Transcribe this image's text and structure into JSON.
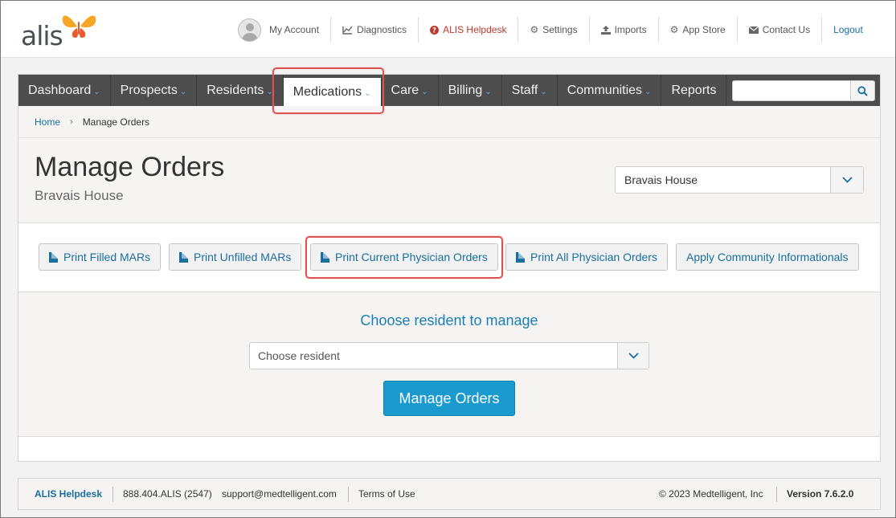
{
  "brand": {
    "logo_text": "alis",
    "logo_color": "#f5a623",
    "logo_accent": "#e85a2c"
  },
  "utility_nav": {
    "my_account": "My Account",
    "diagnostics": "Diagnostics",
    "helpdesk": "ALIS Helpdesk",
    "settings": "Settings",
    "imports": "Imports",
    "app_store": "App Store",
    "contact_us": "Contact Us",
    "logout": "Logout"
  },
  "main_nav": {
    "items": [
      {
        "label": "Dashboard",
        "has_dropdown": true
      },
      {
        "label": "Prospects",
        "has_dropdown": true
      },
      {
        "label": "Residents",
        "has_dropdown": true
      },
      {
        "label": "Medications",
        "has_dropdown": true,
        "active": true
      },
      {
        "label": "Care",
        "has_dropdown": true
      },
      {
        "label": "Billing",
        "has_dropdown": true
      },
      {
        "label": "Staff",
        "has_dropdown": true
      },
      {
        "label": "Communities",
        "has_dropdown": true
      },
      {
        "label": "Reports",
        "has_dropdown": false
      }
    ],
    "search_value": ""
  },
  "breadcrumb": {
    "home": "Home",
    "current": "Manage Orders"
  },
  "page": {
    "title": "Manage Orders",
    "subtitle": "Bravais House",
    "community_selected": "Bravais House"
  },
  "actions": {
    "print_filled_mars": "Print Filled MARs",
    "print_unfilled_mars": "Print Unfilled MARs",
    "print_current_physician_orders": "Print Current Physician Orders",
    "print_all_physician_orders": "Print All Physician Orders",
    "apply_community_informationals": "Apply Community Informationals"
  },
  "manage": {
    "heading": "Choose resident to manage",
    "resident_placeholder": "Choose resident",
    "button": "Manage Orders"
  },
  "footer": {
    "helpdesk": "ALIS Helpdesk",
    "phone": "888.404.ALIS (2547)",
    "email": "support@medtelligent.com",
    "terms": "Terms of Use",
    "copyright": "© 2023 Medtelligent, Inc",
    "version": "Version 7.6.2.0"
  },
  "colors": {
    "nav_bg": "#4d4d4d",
    "link_blue": "#1a6fa0",
    "primary_button": "#1b9ad0",
    "highlight_red": "#e05252",
    "helpdesk_red": "#c0392b"
  },
  "icons": {
    "diagnostics": "line-chart-icon",
    "helpdesk": "question-circle-icon",
    "settings": "gear-icon",
    "imports": "upload-icon",
    "app_store": "gears-icon",
    "contact_us": "envelope-icon",
    "search": "search-icon",
    "print": "file-icon"
  }
}
